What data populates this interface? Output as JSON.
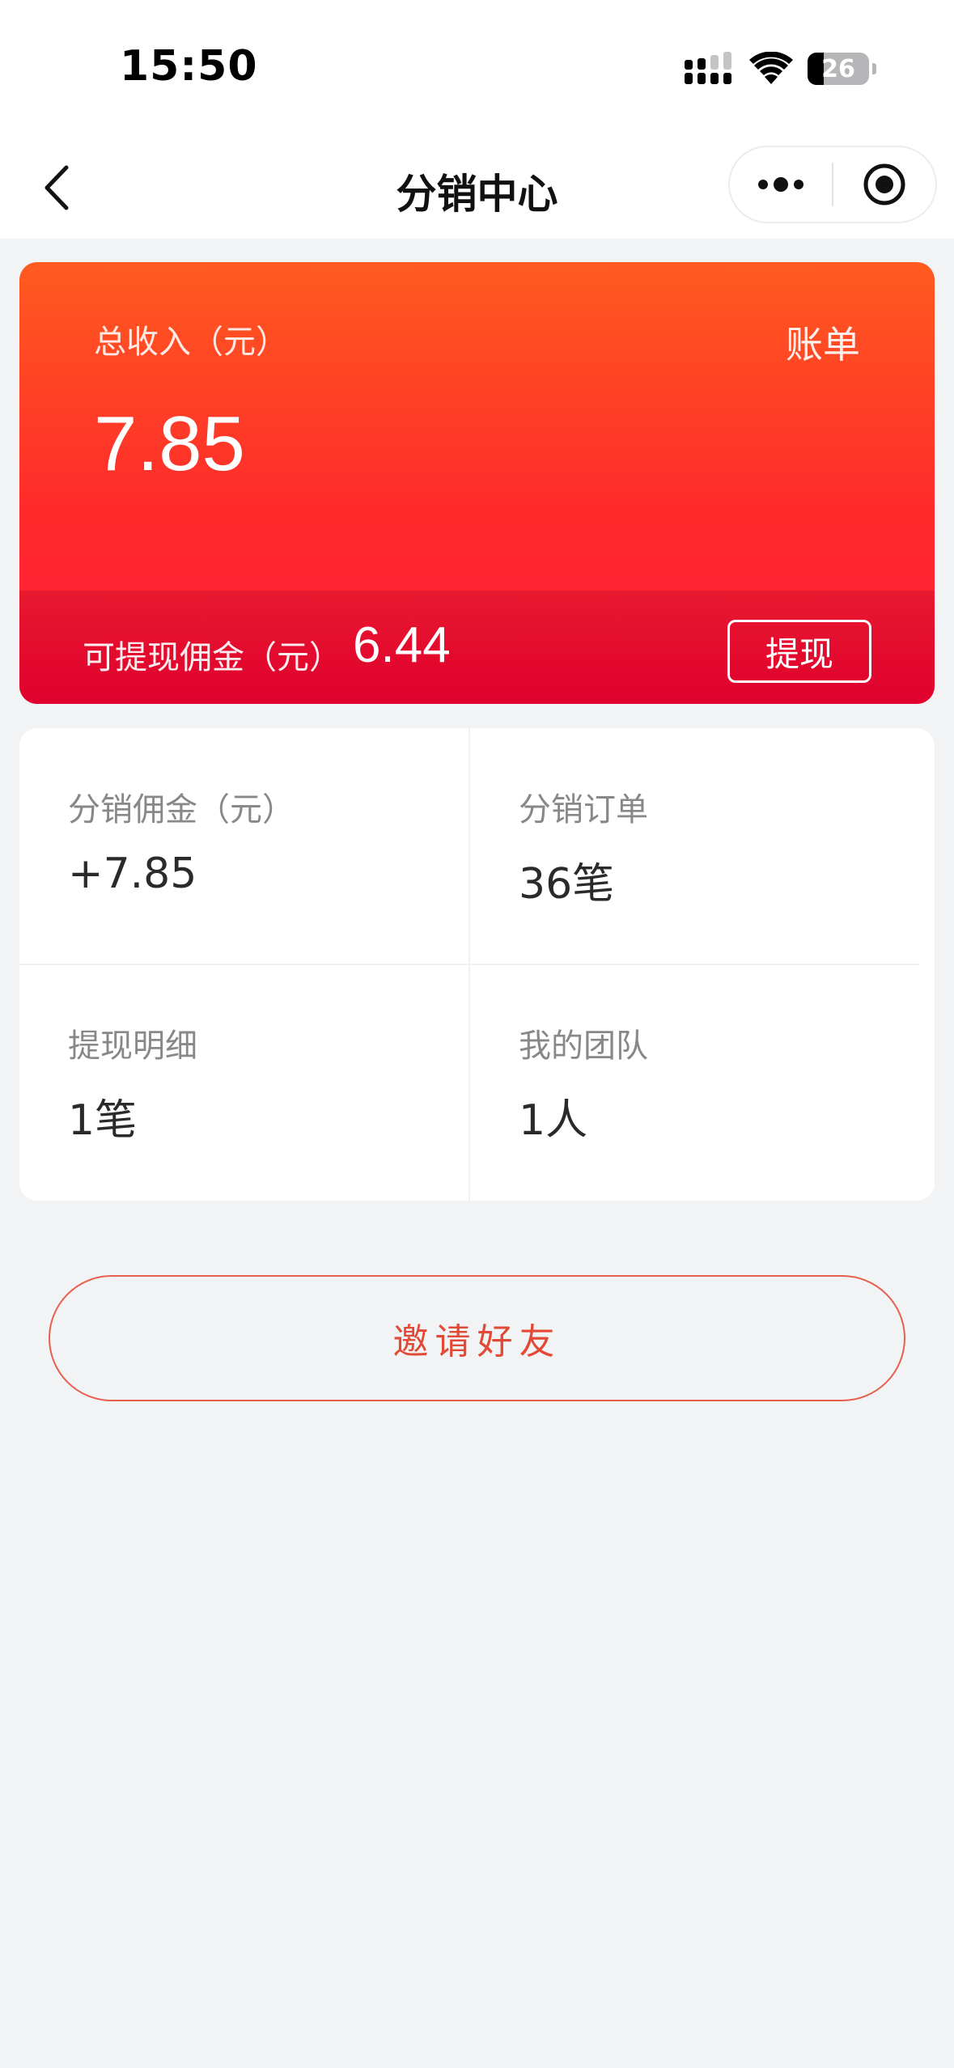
{
  "status_bar": {
    "time": "15:50",
    "battery_level": "26",
    "battery_fraction": 0.26
  },
  "nav": {
    "title": "分销中心",
    "back_icon": "chevron-left-icon",
    "more_icon": "more-dots-icon",
    "close_icon": "target-circle-icon"
  },
  "earnings": {
    "total_label": "总收入（元）",
    "total_value": "7.85",
    "bill_label": "账单",
    "withdrawable_label": "可提现佣金（元）",
    "withdrawable_value": "6.44",
    "withdraw_button": "提现",
    "colors": {
      "gradient_top": "#ff5b1f",
      "gradient_bottom": "#ff1a3a",
      "footer": "#e0002e"
    }
  },
  "stats": [
    {
      "label": "分销佣金（元）",
      "value": "+7.85"
    },
    {
      "label": "分销订单",
      "value": "36笔"
    },
    {
      "label": "提现明细",
      "value": "1笔"
    },
    {
      "label": "我的团队",
      "value": "1人"
    }
  ],
  "invite": {
    "label": "邀请好友",
    "color": "#e24a36"
  }
}
